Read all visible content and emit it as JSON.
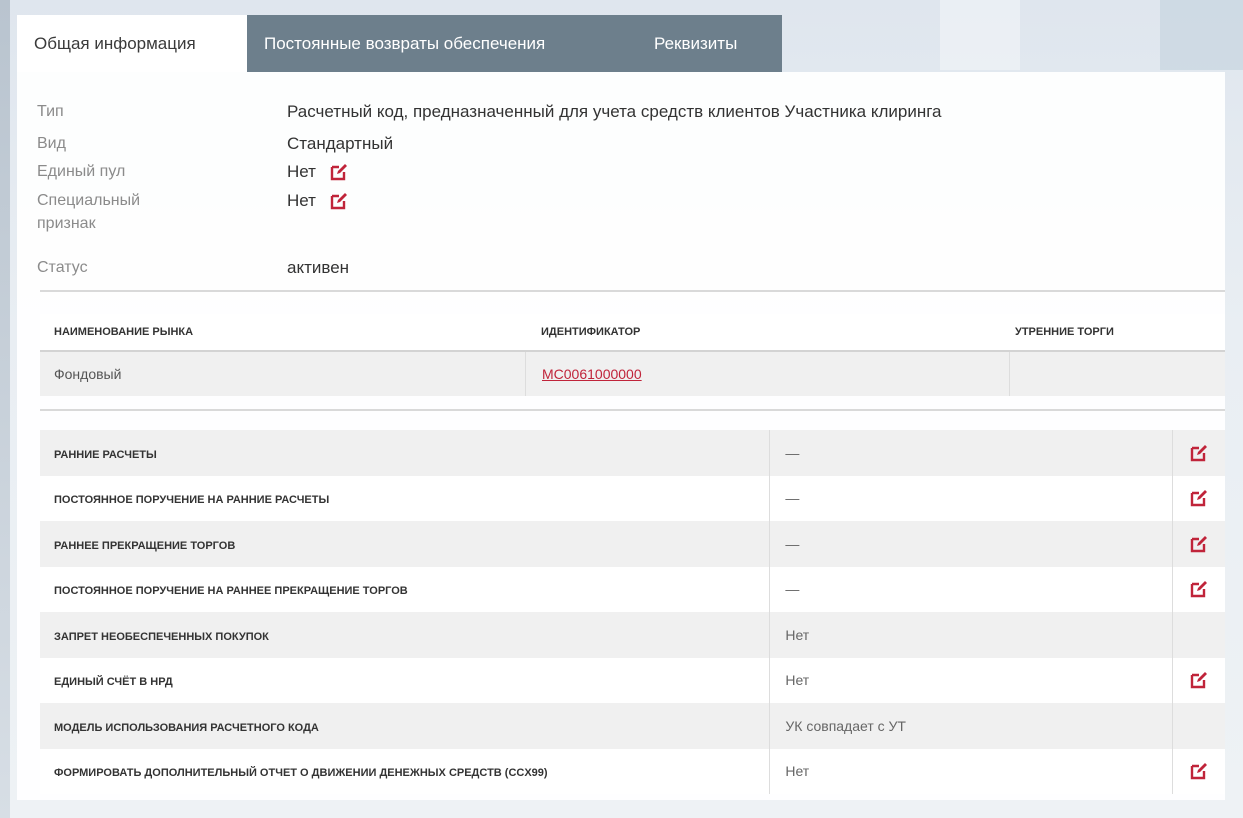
{
  "accent_color": "#c0243a",
  "tabs": [
    {
      "label": "Общая информация",
      "active": true
    },
    {
      "label": "Постоянные возвраты обеспечения",
      "active": false
    },
    {
      "label": "Реквизиты",
      "active": false
    }
  ],
  "info": {
    "type_label": "Тип",
    "type_value": "Расчетный код, предназначенный для учета средств клиентов Участника клиринга",
    "kind_label": "Вид",
    "kind_value": "Стандартный",
    "pool_label": "Единый пул",
    "pool_value": "Нет",
    "special_label_1": "Специальный",
    "special_label_2": "признак",
    "special_value": "Нет",
    "status_label": "Статус",
    "status_value": "активен",
    "edit_icon": "edit-icon"
  },
  "market_table": {
    "headers": [
      "НАИМЕНОВАНИЕ РЫНКА",
      "ИДЕНТИФИКАТОР",
      "УТРЕННИЕ ТОРГИ"
    ],
    "rows": [
      {
        "market": "Фондовый",
        "identifier": "MC0061000000",
        "morning": ""
      }
    ]
  },
  "settings": [
    {
      "label": "РАННИЕ РАСЧЕТЫ",
      "value": "—",
      "editable": true
    },
    {
      "label": "ПОСТОЯННОЕ ПОРУЧЕНИЕ НА РАННИЕ РАСЧЕТЫ",
      "value": "—",
      "editable": true
    },
    {
      "label": "РАННЕЕ ПРЕКРАЩЕНИЕ ТОРГОВ",
      "value": "—",
      "editable": true
    },
    {
      "label": "ПОСТОЯННОЕ ПОРУЧЕНИЕ НА РАННЕЕ ПРЕКРАЩЕНИЕ ТОРГОВ",
      "value": "—",
      "editable": true
    },
    {
      "label": "ЗАПРЕТ НЕОБЕСПЕЧЕННЫХ ПОКУПОК",
      "value": "Нет",
      "editable": false
    },
    {
      "label": "ЕДИНЫЙ СЧЁТ В НРД",
      "value": "Нет",
      "editable": true
    },
    {
      "label": "МОДЕЛЬ ИСПОЛЬЗОВАНИЯ РАСЧЕТНОГО КОДА",
      "value": "УК совпадает с УТ",
      "editable": false
    },
    {
      "label": "ФОРМИРОВАТЬ ДОПОЛНИТЕЛЬНЫЙ ОТЧЕТ О ДВИЖЕНИИ ДЕНЕЖНЫХ СРЕДСТВ (CCX99)",
      "value": "Нет",
      "editable": true
    }
  ]
}
